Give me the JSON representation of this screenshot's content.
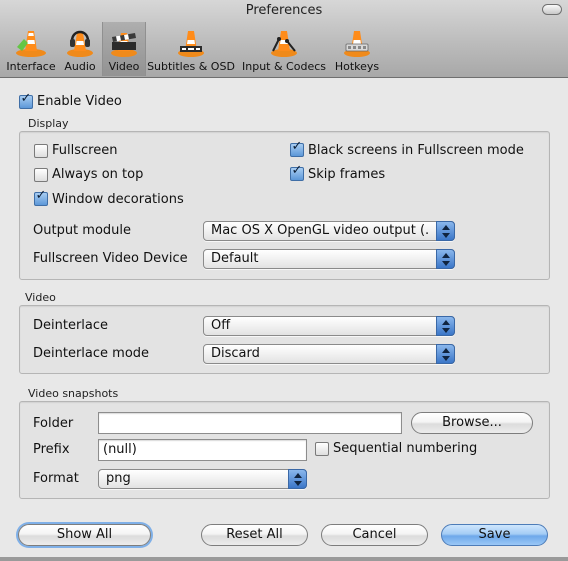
{
  "window": {
    "title": "Preferences"
  },
  "toolbar": {
    "tabs": [
      {
        "label": "Interface"
      },
      {
        "label": "Audio"
      },
      {
        "label": "Video",
        "selected": true
      },
      {
        "label": "Subtitles & OSD"
      },
      {
        "label": "Input & Codecs"
      },
      {
        "label": "Hotkeys"
      }
    ]
  },
  "enable_video": {
    "label": "Enable Video",
    "checked": true
  },
  "display": {
    "title": "Display",
    "fullscreen": {
      "label": "Fullscreen",
      "checked": false
    },
    "always_on_top": {
      "label": "Always on top",
      "checked": false
    },
    "window_decorations": {
      "label": "Window decorations",
      "checked": true
    },
    "black_screens": {
      "label": "Black screens in Fullscreen mode",
      "checked": true
    },
    "skip_frames": {
      "label": "Skip frames",
      "checked": true
    },
    "output_module": {
      "label": "Output module",
      "value": "Mac OS X OpenGL video output (..."
    },
    "fullscreen_device": {
      "label": "Fullscreen Video Device",
      "value": "Default"
    }
  },
  "video": {
    "title": "Video",
    "deinterlace": {
      "label": "Deinterlace",
      "value": "Off"
    },
    "deinterlace_mode": {
      "label": "Deinterlace mode",
      "value": "Discard"
    }
  },
  "snapshots": {
    "title": "Video snapshots",
    "folder": {
      "label": "Folder",
      "value": ""
    },
    "browse_label": "Browse...",
    "prefix": {
      "label": "Prefix",
      "value": "(null)"
    },
    "sequential": {
      "label": "Sequential numbering",
      "checked": false
    },
    "format": {
      "label": "Format",
      "value": "png"
    }
  },
  "buttons": {
    "show_all": "Show All",
    "reset_all": "Reset All",
    "cancel": "Cancel",
    "save": "Save"
  },
  "colors": {
    "accent": "#5d98d8",
    "toolbar": "#bcbcbc",
    "panel": "#e3e3e3"
  }
}
